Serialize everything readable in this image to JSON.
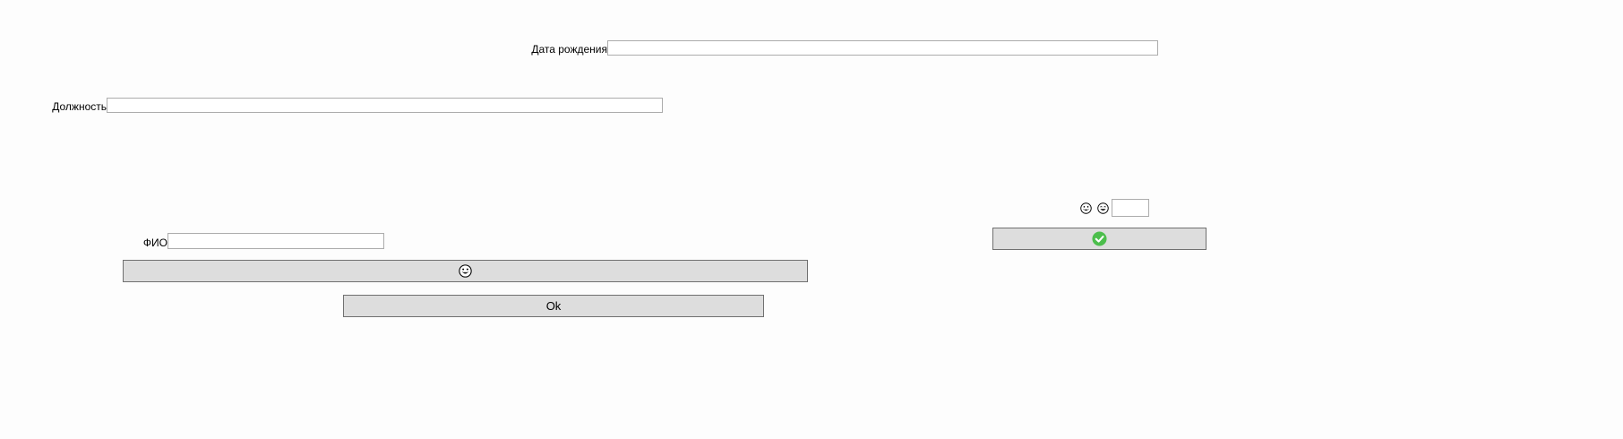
{
  "form": {
    "birth_date": {
      "label": "Дата рождения",
      "value": "",
      "placeholder": ""
    },
    "position": {
      "label": "Должность",
      "value": "",
      "placeholder": ""
    },
    "full_name": {
      "label": "ФИО",
      "value": "",
      "placeholder": ""
    },
    "small_field": {
      "value": "",
      "placeholder": ""
    },
    "icons": {
      "first": "grinning-emoji-icon",
      "second": "smiling-emoji-icon",
      "wide_button": "grinning-emoji-icon",
      "confirm_button": "green-check-icon"
    },
    "ok_button": {
      "label": "Ok"
    }
  },
  "colors": {
    "background": "#fdfdfd",
    "button_face": "#dddddd",
    "button_border": "#707070",
    "field_border": "#acacac",
    "check_green": "#4cbe4c"
  }
}
